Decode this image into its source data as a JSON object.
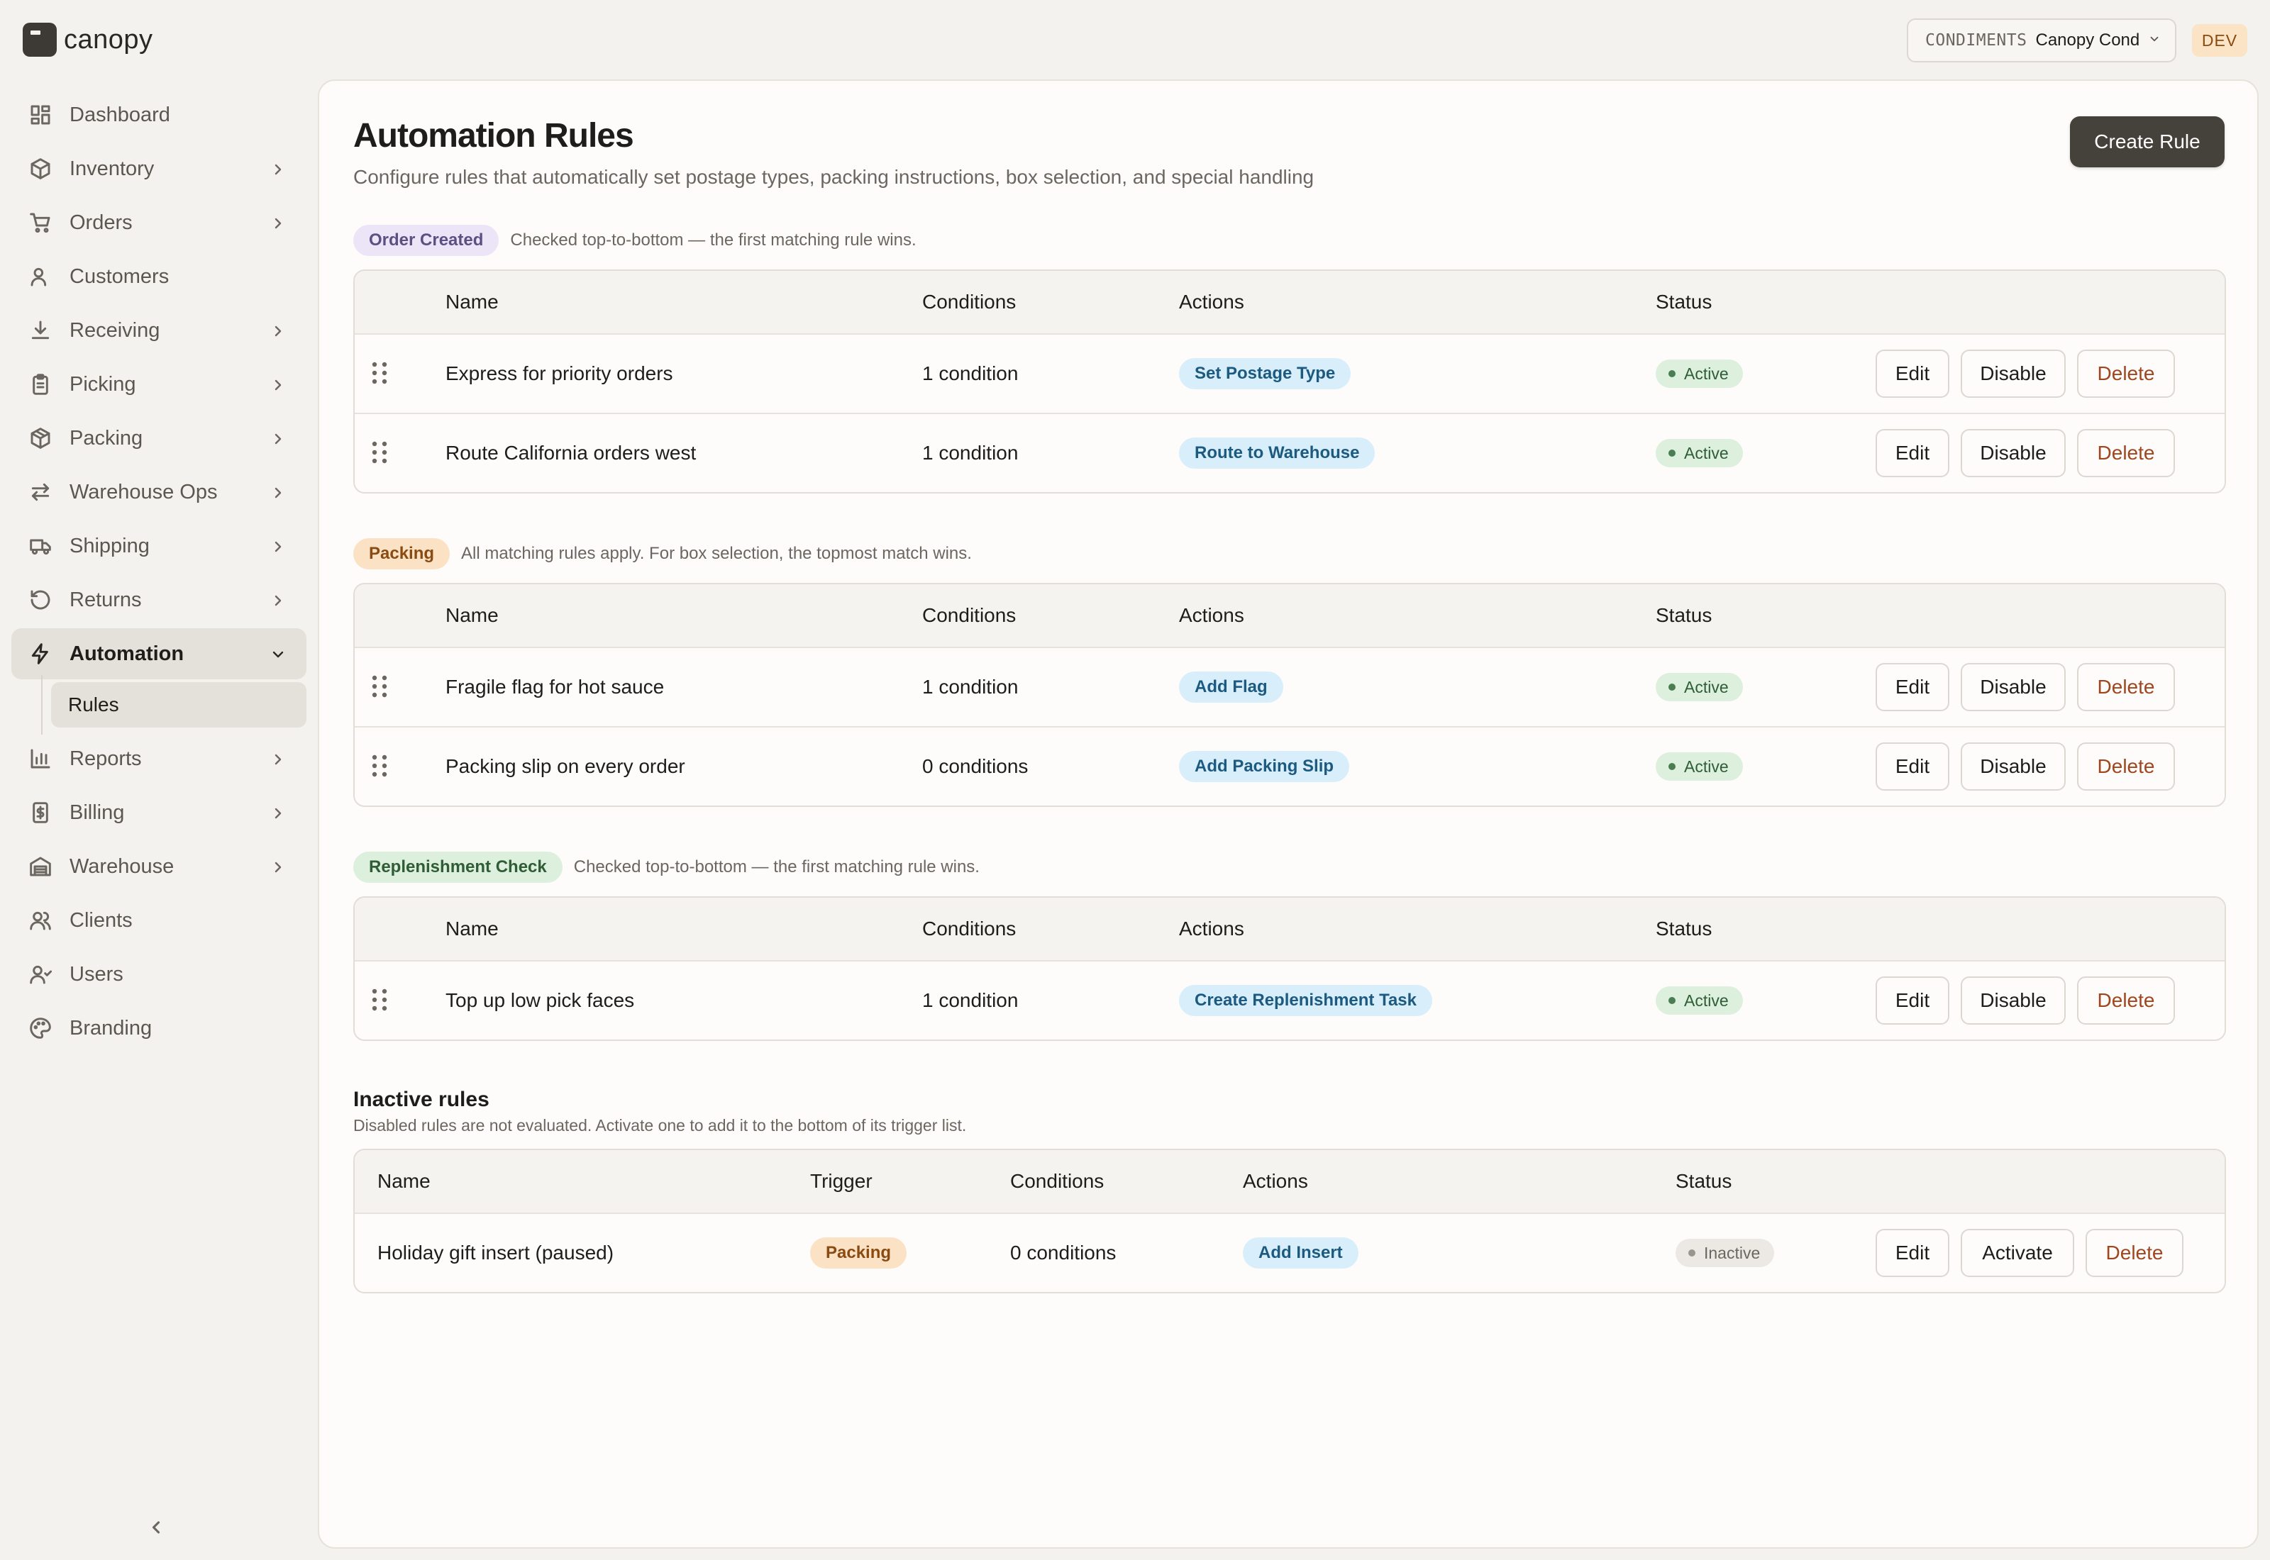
{
  "brand": {
    "name": "canopy"
  },
  "topbar": {
    "org_label": "CONDIMENTS",
    "org_name": "Canopy Cond",
    "env": "DEV"
  },
  "sidebar": {
    "items": [
      {
        "label": "Dashboard",
        "icon": "dashboard-icon",
        "chevron": false
      },
      {
        "label": "Inventory",
        "icon": "box-icon",
        "chevron": true
      },
      {
        "label": "Orders",
        "icon": "cart-icon",
        "chevron": true
      },
      {
        "label": "Customers",
        "icon": "user-icon",
        "chevron": false
      },
      {
        "label": "Receiving",
        "icon": "download-icon",
        "chevron": true
      },
      {
        "label": "Picking",
        "icon": "clipboard-icon",
        "chevron": true
      },
      {
        "label": "Packing",
        "icon": "package-icon",
        "chevron": true
      },
      {
        "label": "Warehouse Ops",
        "icon": "transfer-icon",
        "chevron": true
      },
      {
        "label": "Shipping",
        "icon": "truck-icon",
        "chevron": true
      },
      {
        "label": "Returns",
        "icon": "return-icon",
        "chevron": true
      },
      {
        "label": "Automation",
        "icon": "bolt-icon",
        "chevron": true
      },
      {
        "label": "Reports",
        "icon": "bar-chart-icon",
        "chevron": true
      },
      {
        "label": "Billing",
        "icon": "receipt-icon",
        "chevron": true
      },
      {
        "label": "Warehouse",
        "icon": "warehouse-icon",
        "chevron": true
      },
      {
        "label": "Clients",
        "icon": "users-icon",
        "chevron": false
      },
      {
        "label": "Users",
        "icon": "user-icon",
        "chevron": false
      },
      {
        "label": "Branding",
        "icon": "palette-icon",
        "chevron": false
      }
    ],
    "active": "Automation",
    "sub_item": "Rules"
  },
  "page": {
    "title": "Automation Rules",
    "subtitle": "Configure rules that automatically set postage types, packing instructions, box selection, and special handling",
    "create_button": "Create Rule"
  },
  "columns": {
    "name": "Name",
    "conditions": "Conditions",
    "actions": "Actions",
    "status": "Status",
    "trigger": "Trigger"
  },
  "buttons": {
    "edit": "Edit",
    "disable": "Disable",
    "delete": "Delete",
    "activate": "Activate"
  },
  "sections": [
    {
      "trigger": "Order Created",
      "note": "Checked top-to-bottom — the first matching rule wins.",
      "rules": [
        {
          "name": "Express for priority orders",
          "conditions": "1 condition",
          "action": "Set Postage Type",
          "status": "Active"
        },
        {
          "name": "Route California orders west",
          "conditions": "1 condition",
          "action": "Route to Warehouse",
          "status": "Active"
        }
      ]
    },
    {
      "trigger": "Packing",
      "note": "All matching rules apply. For box selection, the topmost match wins.",
      "rules": [
        {
          "name": "Fragile flag for hot sauce",
          "conditions": "1 condition",
          "action": "Add Flag",
          "status": "Active"
        },
        {
          "name": "Packing slip on every order",
          "conditions": "0 conditions",
          "action": "Add Packing Slip",
          "status": "Active"
        }
      ]
    },
    {
      "trigger": "Replenishment Check",
      "note": "Checked top-to-bottom — the first matching rule wins.",
      "rules": [
        {
          "name": "Top up low pick faces",
          "conditions": "1 condition",
          "action": "Create Replenishment Task",
          "status": "Active"
        }
      ]
    }
  ],
  "inactive": {
    "title": "Inactive rules",
    "note": "Disabled rules are not evaluated. Activate one to add it to the bottom of its trigger list.",
    "rules": [
      {
        "name": "Holiday gift insert (paused)",
        "trigger": "Packing",
        "conditions": "0 conditions",
        "action": "Add Insert",
        "status": "Inactive"
      }
    ]
  },
  "colors": {
    "accent_dark": "#45413b",
    "active_green": "#ddefdd",
    "action_blue": "#d8eefb",
    "danger": "#a0461f"
  }
}
